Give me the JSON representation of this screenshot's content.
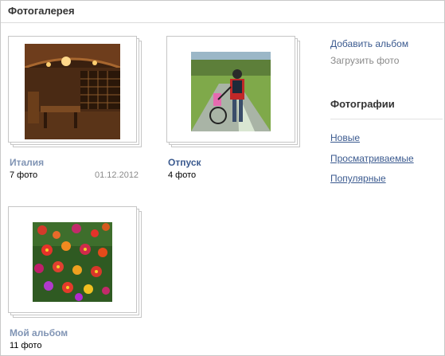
{
  "header": {
    "title": "Фотогалерея"
  },
  "albums": [
    {
      "name": "Италия",
      "count": "7 фото",
      "date": "01.12.2012"
    },
    {
      "name": "Отпуск",
      "count": "4 фото"
    },
    {
      "name": "Мой альбом",
      "count": "11 фото"
    }
  ],
  "sidebar": {
    "actions": [
      "Добавить альбом",
      "Загрузить фото"
    ],
    "heading": "Фотографии",
    "links": [
      "Новые",
      "Просматриваемые",
      "Популярные"
    ]
  },
  "colors": {
    "link": "#3b5a8f",
    "album_title": "#8094b4",
    "muted": "#8a8a8a"
  }
}
